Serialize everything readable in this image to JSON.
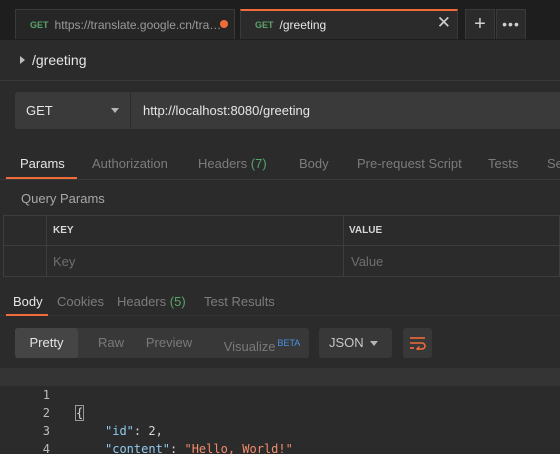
{
  "tabs": [
    {
      "method": "GET",
      "title": "https://translate.google.cn/tran...",
      "unsaved": true
    },
    {
      "method": "GET",
      "title": "/greeting",
      "active": true
    }
  ],
  "request": {
    "name": "/greeting",
    "method": "GET",
    "url": "http://localhost:8080/greeting"
  },
  "request_tabs": [
    {
      "label": "Params",
      "active": true
    },
    {
      "label": "Authorization"
    },
    {
      "label": "Headers",
      "count": "(7)"
    },
    {
      "label": "Body"
    },
    {
      "label": "Pre-request Script"
    },
    {
      "label": "Tests"
    },
    {
      "label": "Se"
    }
  ],
  "query_params": {
    "title": "Query Params",
    "columns": [
      "KEY",
      "VALUE"
    ],
    "placeholders": [
      "Key",
      "Value"
    ]
  },
  "response_tabs": [
    {
      "label": "Body",
      "active": true
    },
    {
      "label": "Cookies"
    },
    {
      "label": "Headers",
      "count": "(5)"
    },
    {
      "label": "Test Results"
    }
  ],
  "response_toolbar": {
    "formats": [
      "Pretty",
      "Raw",
      "Preview",
      "Visualize"
    ],
    "active_format": "Pretty",
    "beta": "BETA",
    "language": "JSON"
  },
  "response_body": {
    "line_numbers": [
      "1",
      "2",
      "3",
      "4"
    ],
    "open_brace": "{",
    "close_brace": "}",
    "id_key": "\"id\"",
    "id_value": "2",
    "content_key": "\"content\"",
    "content_value": "\"Hello, World!\""
  },
  "colors": {
    "accent": "#f26b3a",
    "method_get": "#5aa36a",
    "count": "#5aa36a",
    "beta": "#4a90e2"
  }
}
